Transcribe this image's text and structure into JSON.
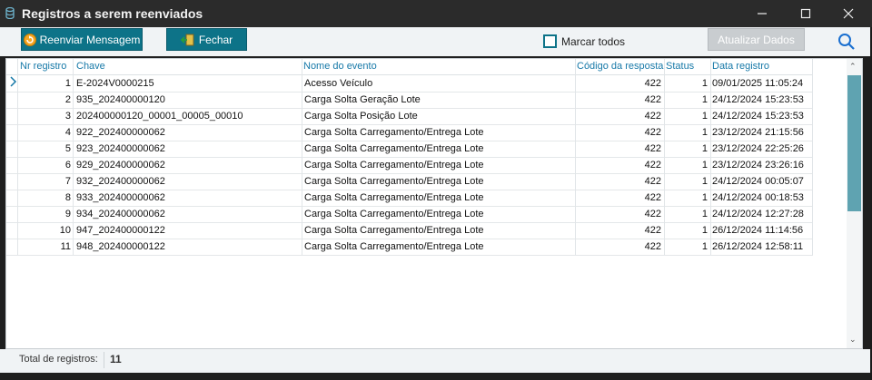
{
  "window": {
    "title": "Registros a serem reenviados",
    "minimize_glyph": "—",
    "maximize_glyph": "☐",
    "close_glyph": "✕"
  },
  "toolbar": {
    "resend_label": "Reenviar Mensagem",
    "close_label": "Fechar",
    "select_all_label": "Marcar todos",
    "refresh_label": "Atualizar Dados"
  },
  "grid": {
    "columns": [
      "Nr registro",
      "Chave",
      "Nome do evento",
      "Código da resposta",
      "Status",
      "Data registro"
    ],
    "rows": [
      {
        "nr": "1",
        "chave": "E-2024V0000215",
        "evento": "Acesso Veículo",
        "codigo": "422",
        "status": "1",
        "data": "09/01/2025 11:05:24"
      },
      {
        "nr": "2",
        "chave": "935_202400000120",
        "evento": "Carga Solta Geração Lote",
        "codigo": "422",
        "status": "1",
        "data": "24/12/2024 15:23:53"
      },
      {
        "nr": "3",
        "chave": "202400000120_00001_00005_00010",
        "evento": "Carga Solta Posição Lote",
        "codigo": "422",
        "status": "1",
        "data": "24/12/2024 15:23:53"
      },
      {
        "nr": "4",
        "chave": "922_202400000062",
        "evento": "Carga Solta Carregamento/Entrega Lote",
        "codigo": "422",
        "status": "1",
        "data": "23/12/2024 21:15:56"
      },
      {
        "nr": "5",
        "chave": "923_202400000062",
        "evento": "Carga Solta Carregamento/Entrega Lote",
        "codigo": "422",
        "status": "1",
        "data": "23/12/2024 22:25:26"
      },
      {
        "nr": "6",
        "chave": "929_202400000062",
        "evento": "Carga Solta Carregamento/Entrega Lote",
        "codigo": "422",
        "status": "1",
        "data": "23/12/2024 23:26:16"
      },
      {
        "nr": "7",
        "chave": "932_202400000062",
        "evento": "Carga Solta Carregamento/Entrega Lote",
        "codigo": "422",
        "status": "1",
        "data": "24/12/2024 00:05:07"
      },
      {
        "nr": "8",
        "chave": "933_202400000062",
        "evento": "Carga Solta Carregamento/Entrega Lote",
        "codigo": "422",
        "status": "1",
        "data": "24/12/2024 00:18:53"
      },
      {
        "nr": "9",
        "chave": "934_202400000062",
        "evento": "Carga Solta Carregamento/Entrega Lote",
        "codigo": "422",
        "status": "1",
        "data": "24/12/2024 12:27:28"
      },
      {
        "nr": "10",
        "chave": "947_202400000122",
        "evento": "Carga Solta Carregamento/Entrega Lote",
        "codigo": "422",
        "status": "1",
        "data": "26/12/2024 11:14:56"
      },
      {
        "nr": "11",
        "chave": "948_202400000122",
        "evento": "Carga Solta Carregamento/Entrega Lote",
        "codigo": "422",
        "status": "1",
        "data": "26/12/2024 12:58:11"
      }
    ]
  },
  "footer": {
    "total_label": "Total de registros:",
    "total_value": "11"
  },
  "colors": {
    "accent": "#0d7388",
    "header_text": "#1779a8",
    "scroll_thumb": "#5fa3b1"
  },
  "icons": [
    "database-icon",
    "minimize-icon",
    "maximize-icon",
    "close-icon",
    "resend-icon",
    "exit-door-icon",
    "search-icon",
    "row-indicator-icon",
    "scroll-up-icon",
    "scroll-down-icon"
  ]
}
